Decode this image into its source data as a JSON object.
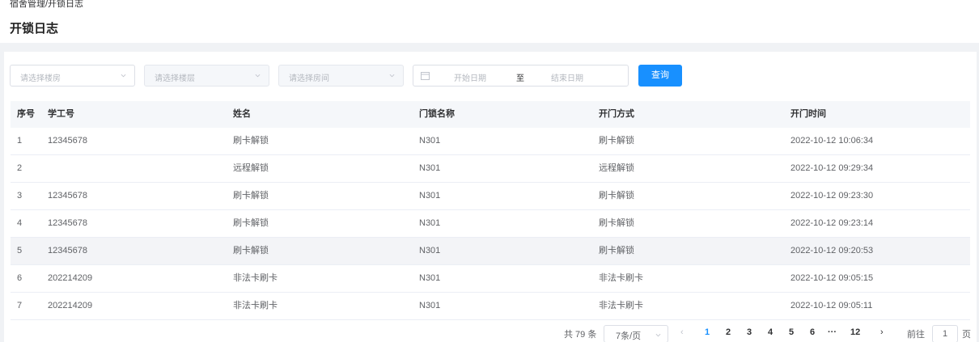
{
  "header": {
    "breadcrumb": "宿舍管理/开锁日志",
    "title": "开锁日志"
  },
  "filters": {
    "building_placeholder": "请选择楼房",
    "floor_placeholder": "请选择楼层",
    "room_placeholder": "请选择房间",
    "start_date_placeholder": "开始日期",
    "range_separator": "至",
    "end_date_placeholder": "结束日期",
    "query_label": "查询"
  },
  "table": {
    "columns": [
      "序号",
      "学工号",
      "姓名",
      "门锁名称",
      "开门方式",
      "开门时间"
    ],
    "rows": [
      [
        "1",
        "12345678",
        "刷卡解锁",
        "N301",
        "刷卡解锁",
        "2022-10-12 10:06:34"
      ],
      [
        "2",
        "",
        "远程解锁",
        "N301",
        "远程解锁",
        "2022-10-12 09:29:34"
      ],
      [
        "3",
        "12345678",
        "刷卡解锁",
        "N301",
        "刷卡解锁",
        "2022-10-12 09:23:30"
      ],
      [
        "4",
        "12345678",
        "刷卡解锁",
        "N301",
        "刷卡解锁",
        "2022-10-12 09:23:14"
      ],
      [
        "5",
        "12345678",
        "刷卡解锁",
        "N301",
        "刷卡解锁",
        "2022-10-12 09:20:53"
      ],
      [
        "6",
        "202214209",
        "非法卡刷卡",
        "N301",
        "非法卡刷卡",
        "2022-10-12 09:05:15"
      ],
      [
        "7",
        "202214209",
        "非法卡刷卡",
        "N301",
        "非法卡刷卡",
        "2022-10-12 09:05:11"
      ]
    ]
  },
  "pagination": {
    "total": "共 79 条",
    "page_size": "7条/页",
    "pages": [
      "1",
      "2",
      "3",
      "4",
      "5",
      "6",
      "···",
      "12"
    ],
    "current_page": "1",
    "prev": "‹",
    "next": "›",
    "goto_label": "前往",
    "goto_value": "1",
    "goto_suffix": "页"
  },
  "colors": {
    "primary": "#1890ff",
    "background": "#f0f2f5",
    "highlight_row": "#f3f4f7"
  },
  "icons": [
    "chevron-down-icon",
    "calendar-icon",
    "chevron-left-icon",
    "chevron-right-icon"
  ]
}
